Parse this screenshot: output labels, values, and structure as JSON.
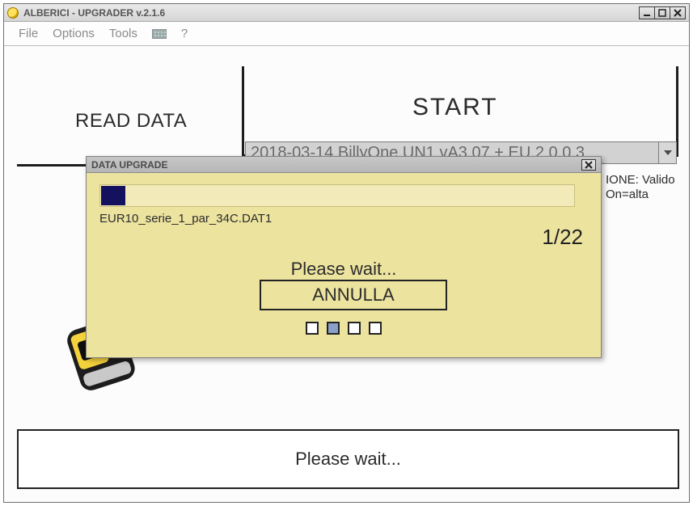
{
  "window": {
    "title": "ALBERICI - UPGRADER v.2.1.6"
  },
  "menu": {
    "file": "File",
    "options": "Options",
    "tools": "Tools",
    "help": "?"
  },
  "main": {
    "read_data_label": "READ DATA",
    "start_label": "START",
    "dropdown_value": "2018-03-14 BillyOne UN1 vA3.07 + EU.2.0.0.3",
    "status_line1": "IONE: Valido",
    "status_line2": "On=alta",
    "bottom_status": "Please wait..."
  },
  "modal": {
    "title": "DATA UPGRADE",
    "current_file": "EUR10_serie_1_par_34C.DAT1",
    "step": "1/22",
    "wait_text": "Please wait...",
    "cancel_label": "ANNULLA",
    "progress_percent": 5,
    "indicators_active_index": 1,
    "indicators_total": 4
  }
}
